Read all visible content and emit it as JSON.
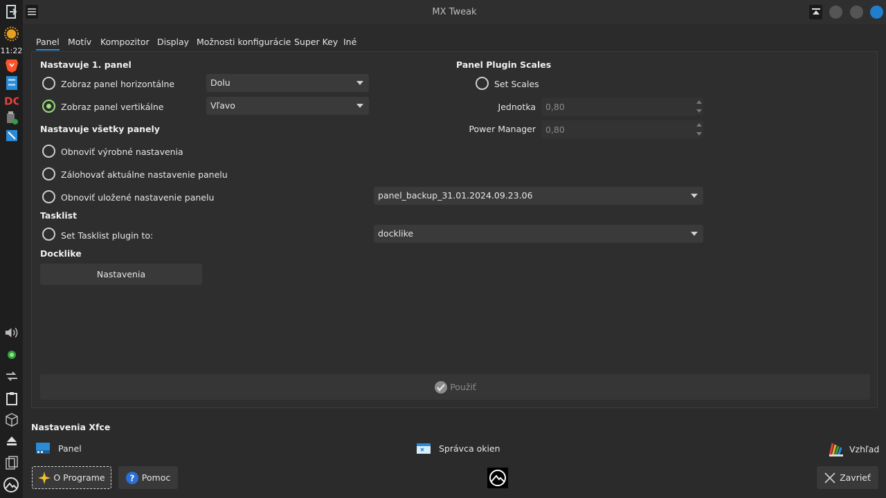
{
  "window": {
    "title": "MX Tweak"
  },
  "leftpanel": {
    "clock": "11:22",
    "icons": [
      "logout-icon",
      "mx-sun-icon",
      "brave-icon",
      "file-manager-icon",
      "doublecmd-icon",
      "usb-icon",
      "screenshot-icon",
      "volume-icon",
      "updater-icon",
      "network-icon",
      "clipboard-icon",
      "package-icon",
      "eject-icon",
      "copy-icon",
      "mx-logo-icon"
    ]
  },
  "tabs": [
    {
      "label": "Panel",
      "active": true
    },
    {
      "label": "Motív"
    },
    {
      "label": "Kompozitor"
    },
    {
      "label": "Display"
    },
    {
      "label": "Možnosti konfigurácie"
    },
    {
      "label": "Super Key"
    },
    {
      "label": "Iné"
    }
  ],
  "panel": {
    "section1_title": "Nastavuje 1. panel",
    "horizontal_label": "Zobraz panel horizontálne",
    "horizontal_value": "Dolu",
    "vertical_label": "Zobraz panel vertikálne",
    "vertical_value": "Vľavo",
    "section2_title": "Nastavuje všetky panely",
    "restore_default": "Obnoviť výrobné nastavenia",
    "backup_current": "Zálohovať aktuálne nastavenie panelu",
    "restore_saved": "Obnoviť uložené nastavenie panelu",
    "backup_value": "panel_backup_31.01.2024.09.23.06",
    "tasklist_title": "Tasklist",
    "tasklist_label": "Set Tasklist plugin to:",
    "tasklist_value": "docklike",
    "docklike_title": "Docklike",
    "docklike_button": "Nastavenia",
    "scales_title": "Panel Plugin Scales",
    "set_scales": "Set Scales",
    "jednotka_label": "Jednotka",
    "jednotka_value": "0,80",
    "power_label": "Power Manager",
    "power_value": "0,80",
    "apply_button": "Použiť"
  },
  "xfce": {
    "title": "Nastavenia Xfce",
    "panel": "Panel",
    "window_manager": "Správca okien",
    "appearance": "Vzhľad"
  },
  "footer": {
    "about": "O Programe",
    "help": "Pomoc",
    "close": "Zavrieť"
  },
  "colors": {
    "accent": "#2a8bd6",
    "radio_on": "#9be07a"
  }
}
